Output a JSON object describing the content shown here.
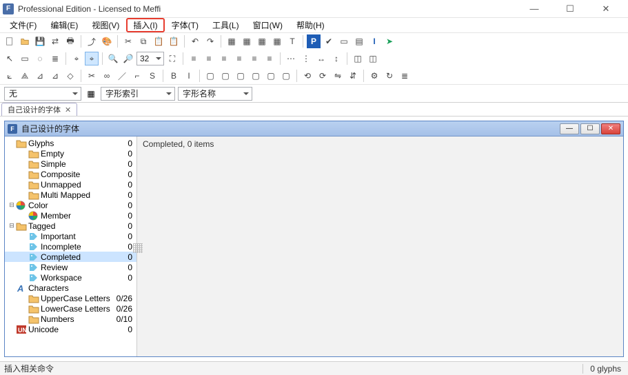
{
  "window": {
    "title": "Professional Edition - Licensed to Meffi"
  },
  "menu": {
    "items": [
      {
        "label": "文件(F)"
      },
      {
        "label": "编辑(E)"
      },
      {
        "label": "视图(V)"
      },
      {
        "label": "插入(I)",
        "highlighted": true
      },
      {
        "label": "字体(T)"
      },
      {
        "label": "工具(L)"
      },
      {
        "label": "窗口(W)"
      },
      {
        "label": "帮助(H)"
      }
    ]
  },
  "toolbar": {
    "zoom_value": "32"
  },
  "filters": {
    "f1": "无",
    "f2": "字形索引",
    "f3": "字形名称"
  },
  "tab": {
    "label": "自己设计的字体"
  },
  "child": {
    "title": "自己设计的字体"
  },
  "tree": [
    {
      "depth": 0,
      "exp": "",
      "icon": "folder",
      "label": "Glyphs",
      "count": "0"
    },
    {
      "depth": 1,
      "exp": "",
      "icon": "folder",
      "label": "Empty",
      "count": "0"
    },
    {
      "depth": 1,
      "exp": "",
      "icon": "folder",
      "label": "Simple",
      "count": "0"
    },
    {
      "depth": 1,
      "exp": "",
      "icon": "folder",
      "label": "Composite",
      "count": "0"
    },
    {
      "depth": 1,
      "exp": "",
      "icon": "folder",
      "label": "Unmapped",
      "count": "0"
    },
    {
      "depth": 1,
      "exp": "",
      "icon": "folder",
      "label": "Multi Mapped",
      "count": "0"
    },
    {
      "depth": 0,
      "exp": "-",
      "icon": "color",
      "label": "Color",
      "count": "0"
    },
    {
      "depth": 1,
      "exp": "",
      "icon": "color",
      "label": "Member",
      "count": "0"
    },
    {
      "depth": 0,
      "exp": "-",
      "icon": "folder",
      "label": "Tagged",
      "count": "0"
    },
    {
      "depth": 1,
      "exp": "",
      "icon": "tag",
      "label": "Important",
      "count": "0"
    },
    {
      "depth": 1,
      "exp": "",
      "icon": "tag",
      "label": "Incomplete",
      "count": "0"
    },
    {
      "depth": 1,
      "exp": "",
      "icon": "tag",
      "label": "Completed",
      "count": "0",
      "selected": true
    },
    {
      "depth": 1,
      "exp": "",
      "icon": "tag",
      "label": "Review",
      "count": "0"
    },
    {
      "depth": 1,
      "exp": "",
      "icon": "tag",
      "label": "Workspace",
      "count": "0"
    },
    {
      "depth": 0,
      "exp": "",
      "icon": "char",
      "label": "Characters",
      "count": ""
    },
    {
      "depth": 1,
      "exp": "",
      "icon": "folder",
      "label": "UpperCase Letters",
      "count": "0/26"
    },
    {
      "depth": 1,
      "exp": "",
      "icon": "folder",
      "label": "LowerCase Letters",
      "count": "0/26"
    },
    {
      "depth": 1,
      "exp": "",
      "icon": "folder",
      "label": "Numbers",
      "count": "0/10"
    },
    {
      "depth": 0,
      "exp": "",
      "icon": "uni",
      "label": "Unicode",
      "count": "0"
    }
  ],
  "content": {
    "header": "Completed, 0 items"
  },
  "status": {
    "left": "插入相关命令",
    "right": "0 glyphs"
  }
}
